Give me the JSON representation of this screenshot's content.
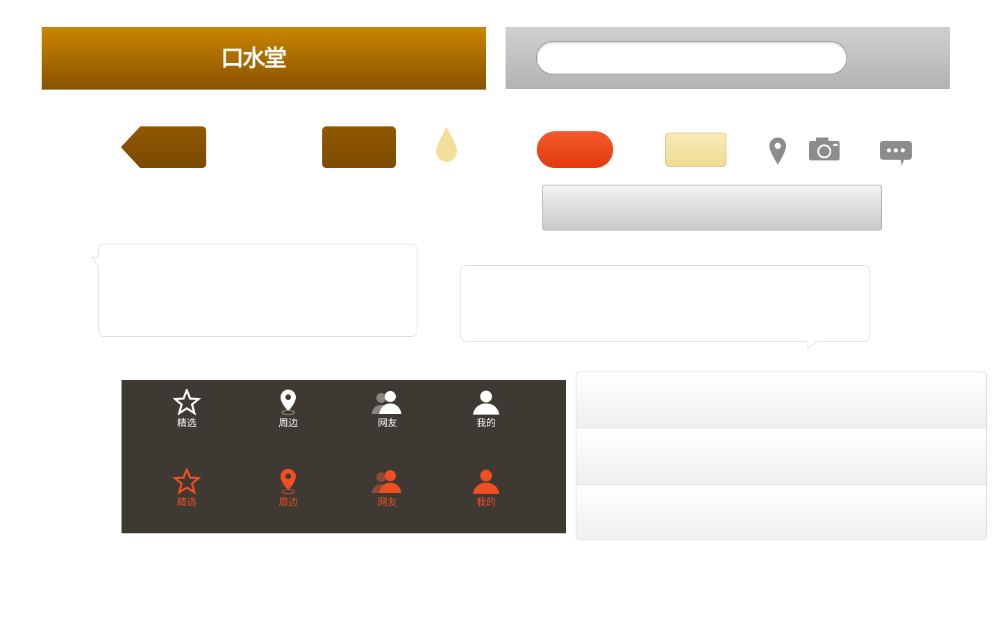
{
  "header": {
    "title": "口水堂",
    "bg_top": "#c98600",
    "bg_bottom": "#8a5200"
  },
  "search": {
    "placeholder": "",
    "value": ""
  },
  "icons": {
    "back": "back-arrow-button",
    "drop": "drop-icon",
    "location": "location-pin-icon",
    "camera": "camera-icon",
    "chat": "chat-bubble-icon"
  },
  "colors": {
    "brown": "#8a5200",
    "accent_red": "#f04e23",
    "yellow": "#f1dc92",
    "dark_panel": "#3e3932"
  },
  "tabbar": {
    "normal": [
      {
        "label": "精选",
        "icon": "star-icon"
      },
      {
        "label": "周边",
        "icon": "location-pin-icon"
      },
      {
        "label": "网友",
        "icon": "friends-icon"
      },
      {
        "label": "我的",
        "icon": "user-icon"
      }
    ],
    "active": [
      {
        "label": "精选",
        "icon": "star-icon"
      },
      {
        "label": "周边",
        "icon": "location-pin-icon"
      },
      {
        "label": "网友",
        "icon": "friends-icon"
      },
      {
        "label": "我的",
        "icon": "user-icon"
      }
    ]
  },
  "list": {
    "rows": [
      "",
      "",
      ""
    ]
  }
}
